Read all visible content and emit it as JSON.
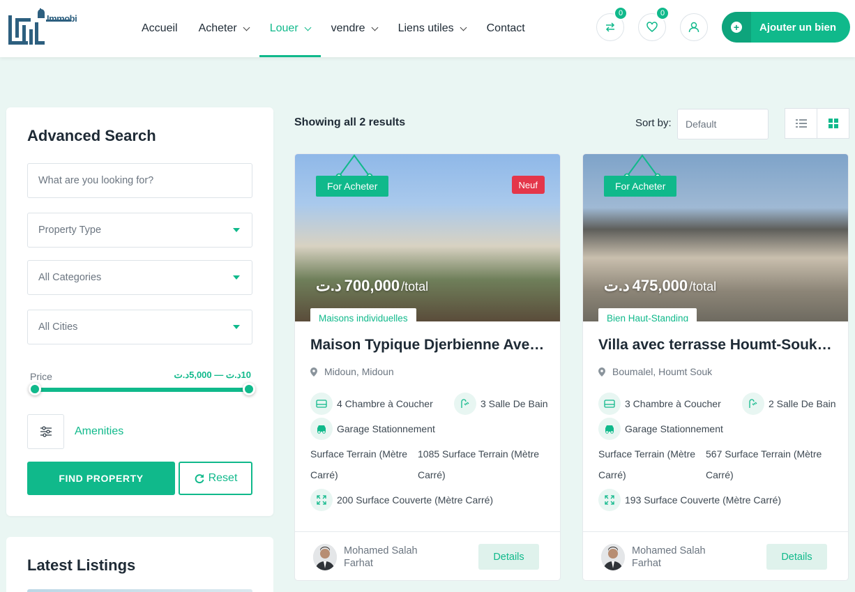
{
  "header": {
    "logo_text": "Immobilier",
    "nav": [
      {
        "label": "Accueil",
        "dropdown": false,
        "active": false
      },
      {
        "label": "Acheter",
        "dropdown": true,
        "active": false
      },
      {
        "label": "Louer",
        "dropdown": true,
        "active": true
      },
      {
        "label": "vendre",
        "dropdown": true,
        "active": false
      },
      {
        "label": "Liens utiles",
        "dropdown": true,
        "active": false
      },
      {
        "label": "Contact",
        "dropdown": false,
        "active": false
      }
    ],
    "compare_count": "0",
    "favorites_count": "0",
    "add_label": "Ajouter un bien"
  },
  "sidebar": {
    "title": "Advanced Search",
    "search_placeholder": "What are you looking for?",
    "property_type": "Property Type",
    "categories": "All Categories",
    "cities": "All Cities",
    "price_label": "Price",
    "price_range": "10د.ت — 5,000د.ت",
    "amenities_label": "Amenities",
    "find_label": "FIND PROPERTY",
    "reset_label": "Reset"
  },
  "latest": {
    "title": "Latest Listings"
  },
  "results": {
    "summary": "Showing all 2 results",
    "sort_label": "Sort by:",
    "sort_value": "Default"
  },
  "colors": {
    "accent": "#10b98b",
    "badge_new": "#e4364a",
    "background": "#eaf6f3"
  },
  "listings": [
    {
      "tag": "For Acheter",
      "badge": "Neuf",
      "price": "700,000",
      "currency": "د.ت",
      "per": "/total",
      "category": "Maisons individuelles",
      "title": "Maison Typique Djerbienne Avec Piscine",
      "location": "Midoun, Midoun",
      "bedrooms": "4 Chambre à Coucher",
      "bathrooms": "3 Salle De Bain",
      "garage": "Garage Stationnement",
      "surface_label": "Surface Terrain (Mètre Carré)",
      "surface_value": "1085 Surface Terrain (Mètre Carré)",
      "covered": "200 Surface Couverte (Mètre Carré)",
      "agent": "Mohamed Salah Farhat",
      "details_label": "Details"
    },
    {
      "tag": "For Acheter",
      "badge": "",
      "price": "475,000",
      "currency": "د.ت",
      "per": "/total",
      "category": "Bien Haut-Standing",
      "title": "Villa avec terrasse Houmt-Souk Djerba",
      "location": "Boumalel, Houmt Souk",
      "bedrooms": "3 Chambre à Coucher",
      "bathrooms": "2 Salle De Bain",
      "garage": "Garage Stationnement",
      "surface_label": "Surface Terrain (Mètre Carré)",
      "surface_value": "567 Surface Terrain (Mètre Carré)",
      "covered": "193 Surface Couverte (Mètre Carré)",
      "agent": "Mohamed Salah Farhat",
      "details_label": "Details"
    }
  ]
}
